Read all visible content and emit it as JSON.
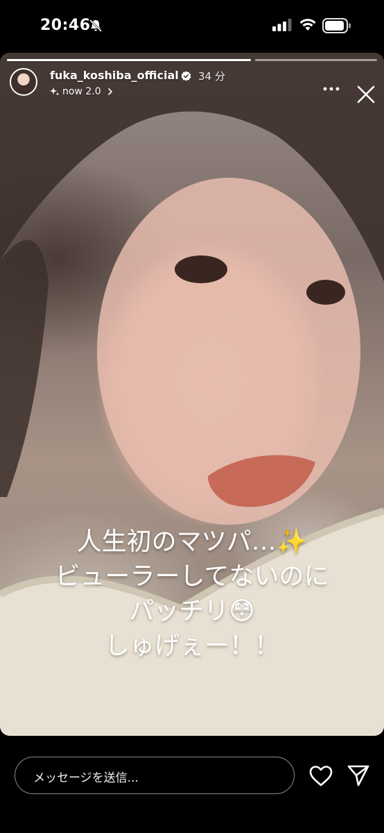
{
  "status_bar": {
    "time": "20:46"
  },
  "story": {
    "progress_segments": [
      {
        "fill": 1.0
      },
      {
        "fill": 0.0
      }
    ],
    "username": "fuka_koshiba_official",
    "time_ago": "34 分",
    "music_label": "now 2.0",
    "caption_lines": [
      "人生初のマツパ…✨",
      "ビューラーしてないのに",
      "パッチリ😳",
      "しゅげぇー！！"
    ]
  },
  "reply": {
    "placeholder": "メッセージを送信..."
  }
}
